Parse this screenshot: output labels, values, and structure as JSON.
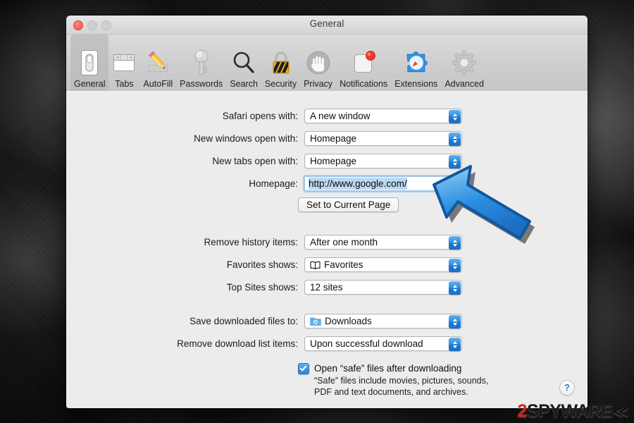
{
  "window": {
    "title": "General",
    "traffic_lights": [
      "close",
      "minimize",
      "zoom"
    ]
  },
  "toolbar": {
    "items": [
      {
        "label": "General",
        "icon": "switch-icon",
        "selected": true
      },
      {
        "label": "Tabs",
        "icon": "tabs-icon",
        "selected": false
      },
      {
        "label": "AutoFill",
        "icon": "pencil-icon",
        "selected": false
      },
      {
        "label": "Passwords",
        "icon": "key-icon",
        "selected": false
      },
      {
        "label": "Search",
        "icon": "magnifier-icon",
        "selected": false
      },
      {
        "label": "Security",
        "icon": "padlock-icon",
        "selected": false
      },
      {
        "label": "Privacy",
        "icon": "hand-icon",
        "selected": false
      },
      {
        "label": "Notifications",
        "icon": "notification-icon",
        "selected": false
      },
      {
        "label": "Extensions",
        "icon": "puzzle-compass-icon",
        "selected": false
      },
      {
        "label": "Advanced",
        "icon": "gear-icon",
        "selected": false
      }
    ]
  },
  "form": {
    "safari_opens_with": {
      "label": "Safari opens with:",
      "value": "A new window"
    },
    "new_windows_open_with": {
      "label": "New windows open with:",
      "value": "Homepage"
    },
    "new_tabs_open_with": {
      "label": "New tabs open with:",
      "value": "Homepage"
    },
    "homepage": {
      "label": "Homepage:",
      "value": "http://www.google.com/"
    },
    "set_current_page_button": "Set to Current Page",
    "remove_history_items": {
      "label": "Remove history items:",
      "value": "After one month"
    },
    "favorites_shows": {
      "label": "Favorites shows:",
      "value": "Favorites",
      "icon": "book-icon"
    },
    "top_sites_shows": {
      "label": "Top Sites shows:",
      "value": "12 sites"
    },
    "save_downloaded_files_to": {
      "label": "Save downloaded files to:",
      "value": "Downloads",
      "icon": "downloads-folder-icon"
    },
    "remove_download_list": {
      "label": "Remove download list items:",
      "value": "Upon successful download"
    },
    "open_safe_files": {
      "label": "Open “safe” files after downloading",
      "checked": true
    },
    "open_safe_files_note": "“Safe” files include movies, pictures, sounds, PDF and text documents, and archives."
  },
  "help_button": {
    "glyph": "?"
  },
  "cursor": {
    "type": "arrow-cursor",
    "color": "#2a8ae0",
    "points_to": "homepage-field"
  },
  "watermark": {
    "prefix": "2",
    "text": "SPYWARE",
    "mark": "≪"
  },
  "colors": {
    "accent_blue": "#2f8de0",
    "selection_blue": "#bcd9f2",
    "window_bg": "#ececec",
    "watermark_red": "#d9201f"
  }
}
